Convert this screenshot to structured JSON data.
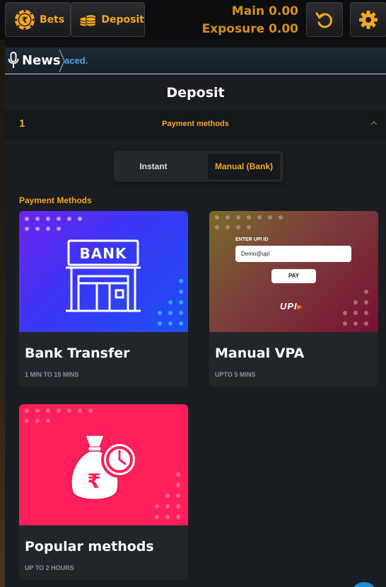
{
  "topbar": {
    "bets_label": "Bets",
    "deposit_label": "Deposit",
    "main_label": "Main",
    "main_value": "0.00",
    "exposure_label": "Exposure",
    "exposure_value": "0.00",
    "accent_color": "#f5a623"
  },
  "news": {
    "label": "News",
    "ticker_text": "aced."
  },
  "page": {
    "title": "Deposit"
  },
  "accordion": {
    "step": "1",
    "title": "Payment methods"
  },
  "toggle": {
    "options": [
      "Instant",
      "Manual (Bank)"
    ],
    "selected": "Manual (Bank)"
  },
  "section": {
    "label": "Payment Methods"
  },
  "methods": [
    {
      "title": "Bank Transfer",
      "subtitle": "1 MIN TO 15 MINS",
      "image_text": "BANK",
      "icon": "bank-building-icon"
    },
    {
      "title": "Manual VPA",
      "subtitle": "UPTO 5 MINS",
      "icon": "upi-form-icon",
      "upi_field_label": "ENTER UPI ID",
      "upi_input_value": "Demo@upi",
      "upi_pay_label": "PAY",
      "upi_logo": "UPI"
    },
    {
      "title": "Popular methods",
      "subtitle": "UP TO 2 HOURS",
      "icon": "money-bag-clock-icon"
    }
  ]
}
